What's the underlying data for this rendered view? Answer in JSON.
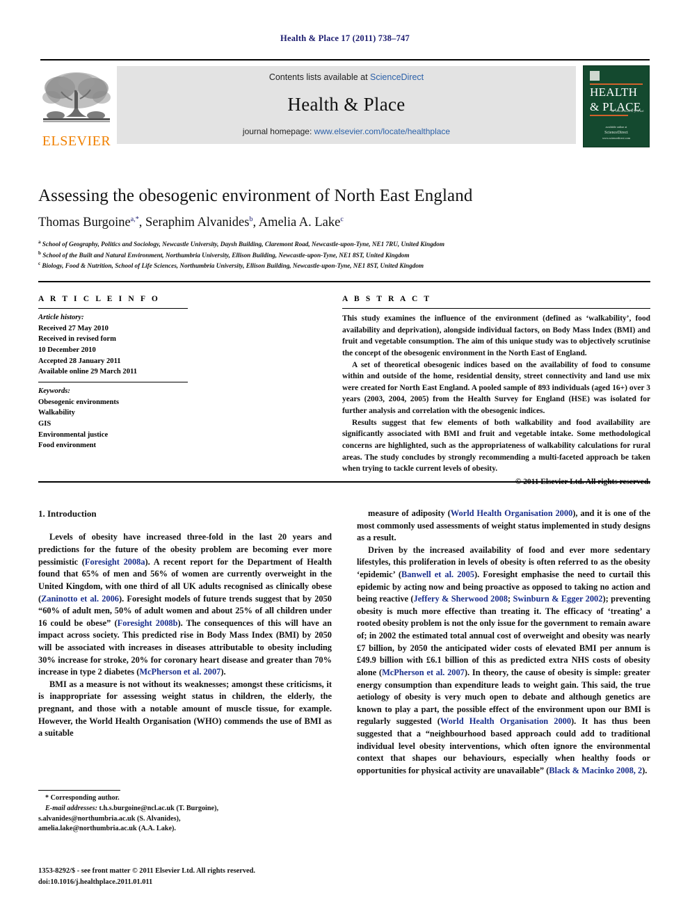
{
  "running_head": "Health & Place 17 (2011) 738–747",
  "masthead": {
    "publisher_wordmark": "ELSEVIER",
    "contents_prefix": "Contents lists available at ",
    "contents_link": "ScienceDirect",
    "journal_name": "Health & Place",
    "homepage_prefix": "journal homepage: ",
    "homepage_url": "www.elsevier.com/locate/healthplace",
    "cover": {
      "line1": "HEALTH",
      "line2": "& PLACE",
      "subtitle": "an international journal",
      "footer_top": "available online at",
      "footer_brand": "ScienceDirect",
      "footer_url": "www.sciencedirect.com"
    }
  },
  "article": {
    "title": "Assessing the obesogenic environment of North East England",
    "authors": [
      {
        "name": "Thomas Burgoine",
        "sup": "a,*"
      },
      {
        "name": "Seraphim Alvanides",
        "sup": "b"
      },
      {
        "name": "Amelia A. Lake",
        "sup": "c"
      }
    ],
    "affiliations": [
      {
        "marker": "a",
        "text": "School of Geography, Politics and Sociology, Newcastle University, Daysh Building, Claremont Road, Newcastle-upon-Tyne, NE1 7RU, United Kingdom"
      },
      {
        "marker": "b",
        "text": "School of the Built and Natural Environment, Northumbria University, Ellison Building, Newcastle-upon-Tyne, NE1 8ST, United Kingdom"
      },
      {
        "marker": "c",
        "text": "Biology, Food & Nutrition, School of Life Sciences, Northumbria University, Ellison Building, Newcastle-upon-Tyne, NE1 8ST, United Kingdom"
      }
    ]
  },
  "article_info": {
    "heading": "A R T I C L E   I N F O",
    "history_label": "Article history:",
    "history": [
      "Received 27 May 2010",
      "Received in revised form",
      "10 December 2010",
      "Accepted 28 January 2011",
      "Available online 29 March 2011"
    ],
    "keywords_label": "Keywords:",
    "keywords": [
      "Obesogenic environments",
      "Walkability",
      "GIS",
      "Environmental justice",
      "Food environment"
    ]
  },
  "abstract": {
    "heading": "A B S T R A C T",
    "paragraphs": [
      "This study examines the influence of the environment (defined as ‘walkability’, food availability and deprivation), alongside individual factors, on Body Mass Index (BMI) and fruit and vegetable consumption. The aim of this unique study was to objectively scrutinise the concept of the obesogenic environment in the North East of England.",
      "A set of theoretical obesogenic indices based on the availability of food to consume within and outside of the home, residential density, street connectivity and land use mix were created for North East England. A pooled sample of 893 individuals (aged 16+) over 3 years (2003, 2004, 2005) from the Health Survey for England (HSE) was isolated for further analysis and correlation with the obesogenic indices.",
      "Results suggest that few elements of both walkability and food availability are significantly associated with BMI and fruit and vegetable intake. Some methodological concerns are highlighted, such as the appropriateness of walkability calculations for rural areas. The study concludes by strongly recommending a multi-faceted approach be taken when trying to tackle current levels of obesity."
    ],
    "copyright": "© 2011 Elsevier Ltd. All rights reserved."
  },
  "introduction": {
    "heading": "1. Introduction",
    "left_paragraphs": [
      "Levels of obesity have increased three-fold in the last 20 years and predictions for the future of the obesity problem are becoming ever more pessimistic (Foresight 2008a). A recent report for the Department of Health found that 65% of men and 56% of women are currently overweight in the United Kingdom, with one third of all UK adults recognised as clinically obese (Zaninotto et al. 2006). Foresight models of future trends suggest that by 2050 “60% of adult men, 50% of adult women and about 25% of all children under 16 could be obese” (Foresight 2008b). The consequences of this will have an impact across society. This predicted rise in Body Mass Index (BMI) by 2050 will be associated with increases in diseases attributable to obesity including 30% increase for stroke, 20% for coronary heart disease and greater than 70% increase in type 2 diabetes (McPherson et al. 2007).",
      "BMI as a measure is not without its weaknesses; amongst these criticisms, it is inappropriate for assessing weight status in children, the elderly, the pregnant, and those with a notable amount of muscle tissue, for example. However, the World Health Organisation (WHO) commends the use of BMI as a suitable"
    ],
    "right_paragraphs": [
      "measure of adiposity (World Health Organisation 2000), and it is one of the most commonly used assessments of weight status implemented in study designs as a result.",
      "Driven by the increased availability of food and ever more sedentary lifestyles, this proliferation in levels of obesity is often referred to as the obesity ‘epidemic’ (Banwell et al. 2005). Foresight emphasise the need to curtail this epidemic by acting now and being proactive as opposed to taking no action and being reactive (Jeffery & Sherwood 2008; Swinburn & Egger 2002); preventing obesity is much more effective than treating it. The efficacy of ‘treating’ a rooted obesity problem is not the only issue for the government to remain aware of; in 2002 the estimated total annual cost of overweight and obesity was nearly £7 billion, by 2050 the anticipated wider costs of elevated BMI per annum is £49.9 billion with £6.1 billion of this as predicted extra NHS costs of obesity alone (McPherson et al. 2007). In theory, the cause of obesity is simple: greater energy consumption than expenditure leads to weight gain. This said, the true aetiology of obesity is very much open to debate and although genetics are known to play a part, the possible effect of the environment upon our BMI is regularly suggested (World Health Organisation 2000). It has thus been suggested that a “neighbourhood based approach could add to traditional individual level obesity interventions, which often ignore the environmental context that shapes our behaviours, especially when healthy foods or opportunities for physical activity are unavailable” (Black & Macinko 2008, 2)."
    ],
    "citations_left": [
      "Foresight 2008a",
      "Zaninotto et al. 2006",
      "Foresight 2008b",
      "McPherson et al. 2007"
    ],
    "citations_right": [
      "World Health Organisation 2000",
      "Banwell et al. 2005",
      "Jeffery & Sherwood 2008",
      "Swinburn & Egger 2002",
      "McPherson et al. 2007",
      "World Health Organisation 2000",
      "Black & Macinko 2008, 2"
    ]
  },
  "footnotes": {
    "corresponding": "* Corresponding author.",
    "emails_label": "E-mail addresses:",
    "emails": [
      "t.h.s.burgoine@ncl.ac.uk (T. Burgoine),",
      "s.alvanides@northumbria.ac.uk (S. Alvanides),",
      "amelia.lake@northumbria.ac.uk (A.A. Lake)."
    ]
  },
  "imprint": {
    "line1": "1353-8292/$ - see front matter © 2011 Elsevier Ltd. All rights reserved.",
    "line2": "doi:10.1016/j.healthplace.2011.01.011"
  },
  "colors": {
    "running_head": "#1a1a6e",
    "citation_link": "#1a2f8c",
    "sciencedirect_blue": "#2b60a8",
    "elsevier_orange": "#F08000",
    "cover_green": "#14492f",
    "banner_gray": "#e3e3e3"
  }
}
